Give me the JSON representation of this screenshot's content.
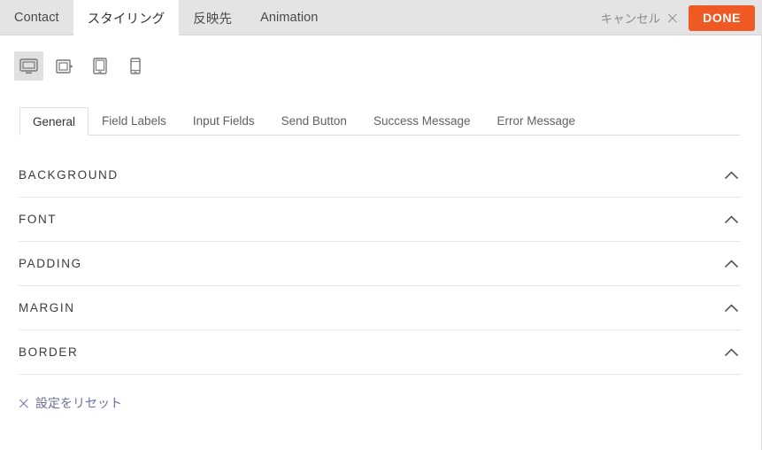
{
  "topbar": {
    "nav_items": [
      {
        "label": "Contact",
        "active": false
      },
      {
        "label": "スタイリング",
        "active": true
      },
      {
        "label": "反映先",
        "active": false
      },
      {
        "label": "Animation",
        "active": false
      }
    ],
    "cancel_label": "キャンセル",
    "cancel_icon": "close-icon",
    "done_label": "DONE",
    "done_color": "#ef5a24",
    "background_color": "#e4e4e4"
  },
  "device_toolbar": {
    "devices": [
      {
        "name": "desktop",
        "icon": "desktop-icon",
        "active": true
      },
      {
        "name": "laptop",
        "icon": "laptop-icon",
        "active": false
      },
      {
        "name": "tablet",
        "icon": "tablet-icon",
        "active": false
      },
      {
        "name": "mobile",
        "icon": "mobile-icon",
        "active": false
      }
    ]
  },
  "tabs": [
    {
      "label": "General",
      "active": true
    },
    {
      "label": "Field Labels",
      "active": false
    },
    {
      "label": "Input Fields",
      "active": false
    },
    {
      "label": "Send Button",
      "active": false
    },
    {
      "label": "Success Message",
      "active": false
    },
    {
      "label": "Error Message",
      "active": false
    }
  ],
  "sections": [
    {
      "title": "BACKGROUND",
      "expanded": true,
      "icon": "chevron-up-icon"
    },
    {
      "title": "FONT",
      "expanded": true,
      "icon": "chevron-up-icon"
    },
    {
      "title": "PADDING",
      "expanded": true,
      "icon": "chevron-up-icon"
    },
    {
      "title": "MARGIN",
      "expanded": true,
      "icon": "chevron-up-icon"
    },
    {
      "title": "BORDER",
      "expanded": true,
      "icon": "chevron-up-icon"
    }
  ],
  "reset": {
    "label": "設定をリセット",
    "icon": "close-icon",
    "color": "#6b6f9e"
  }
}
